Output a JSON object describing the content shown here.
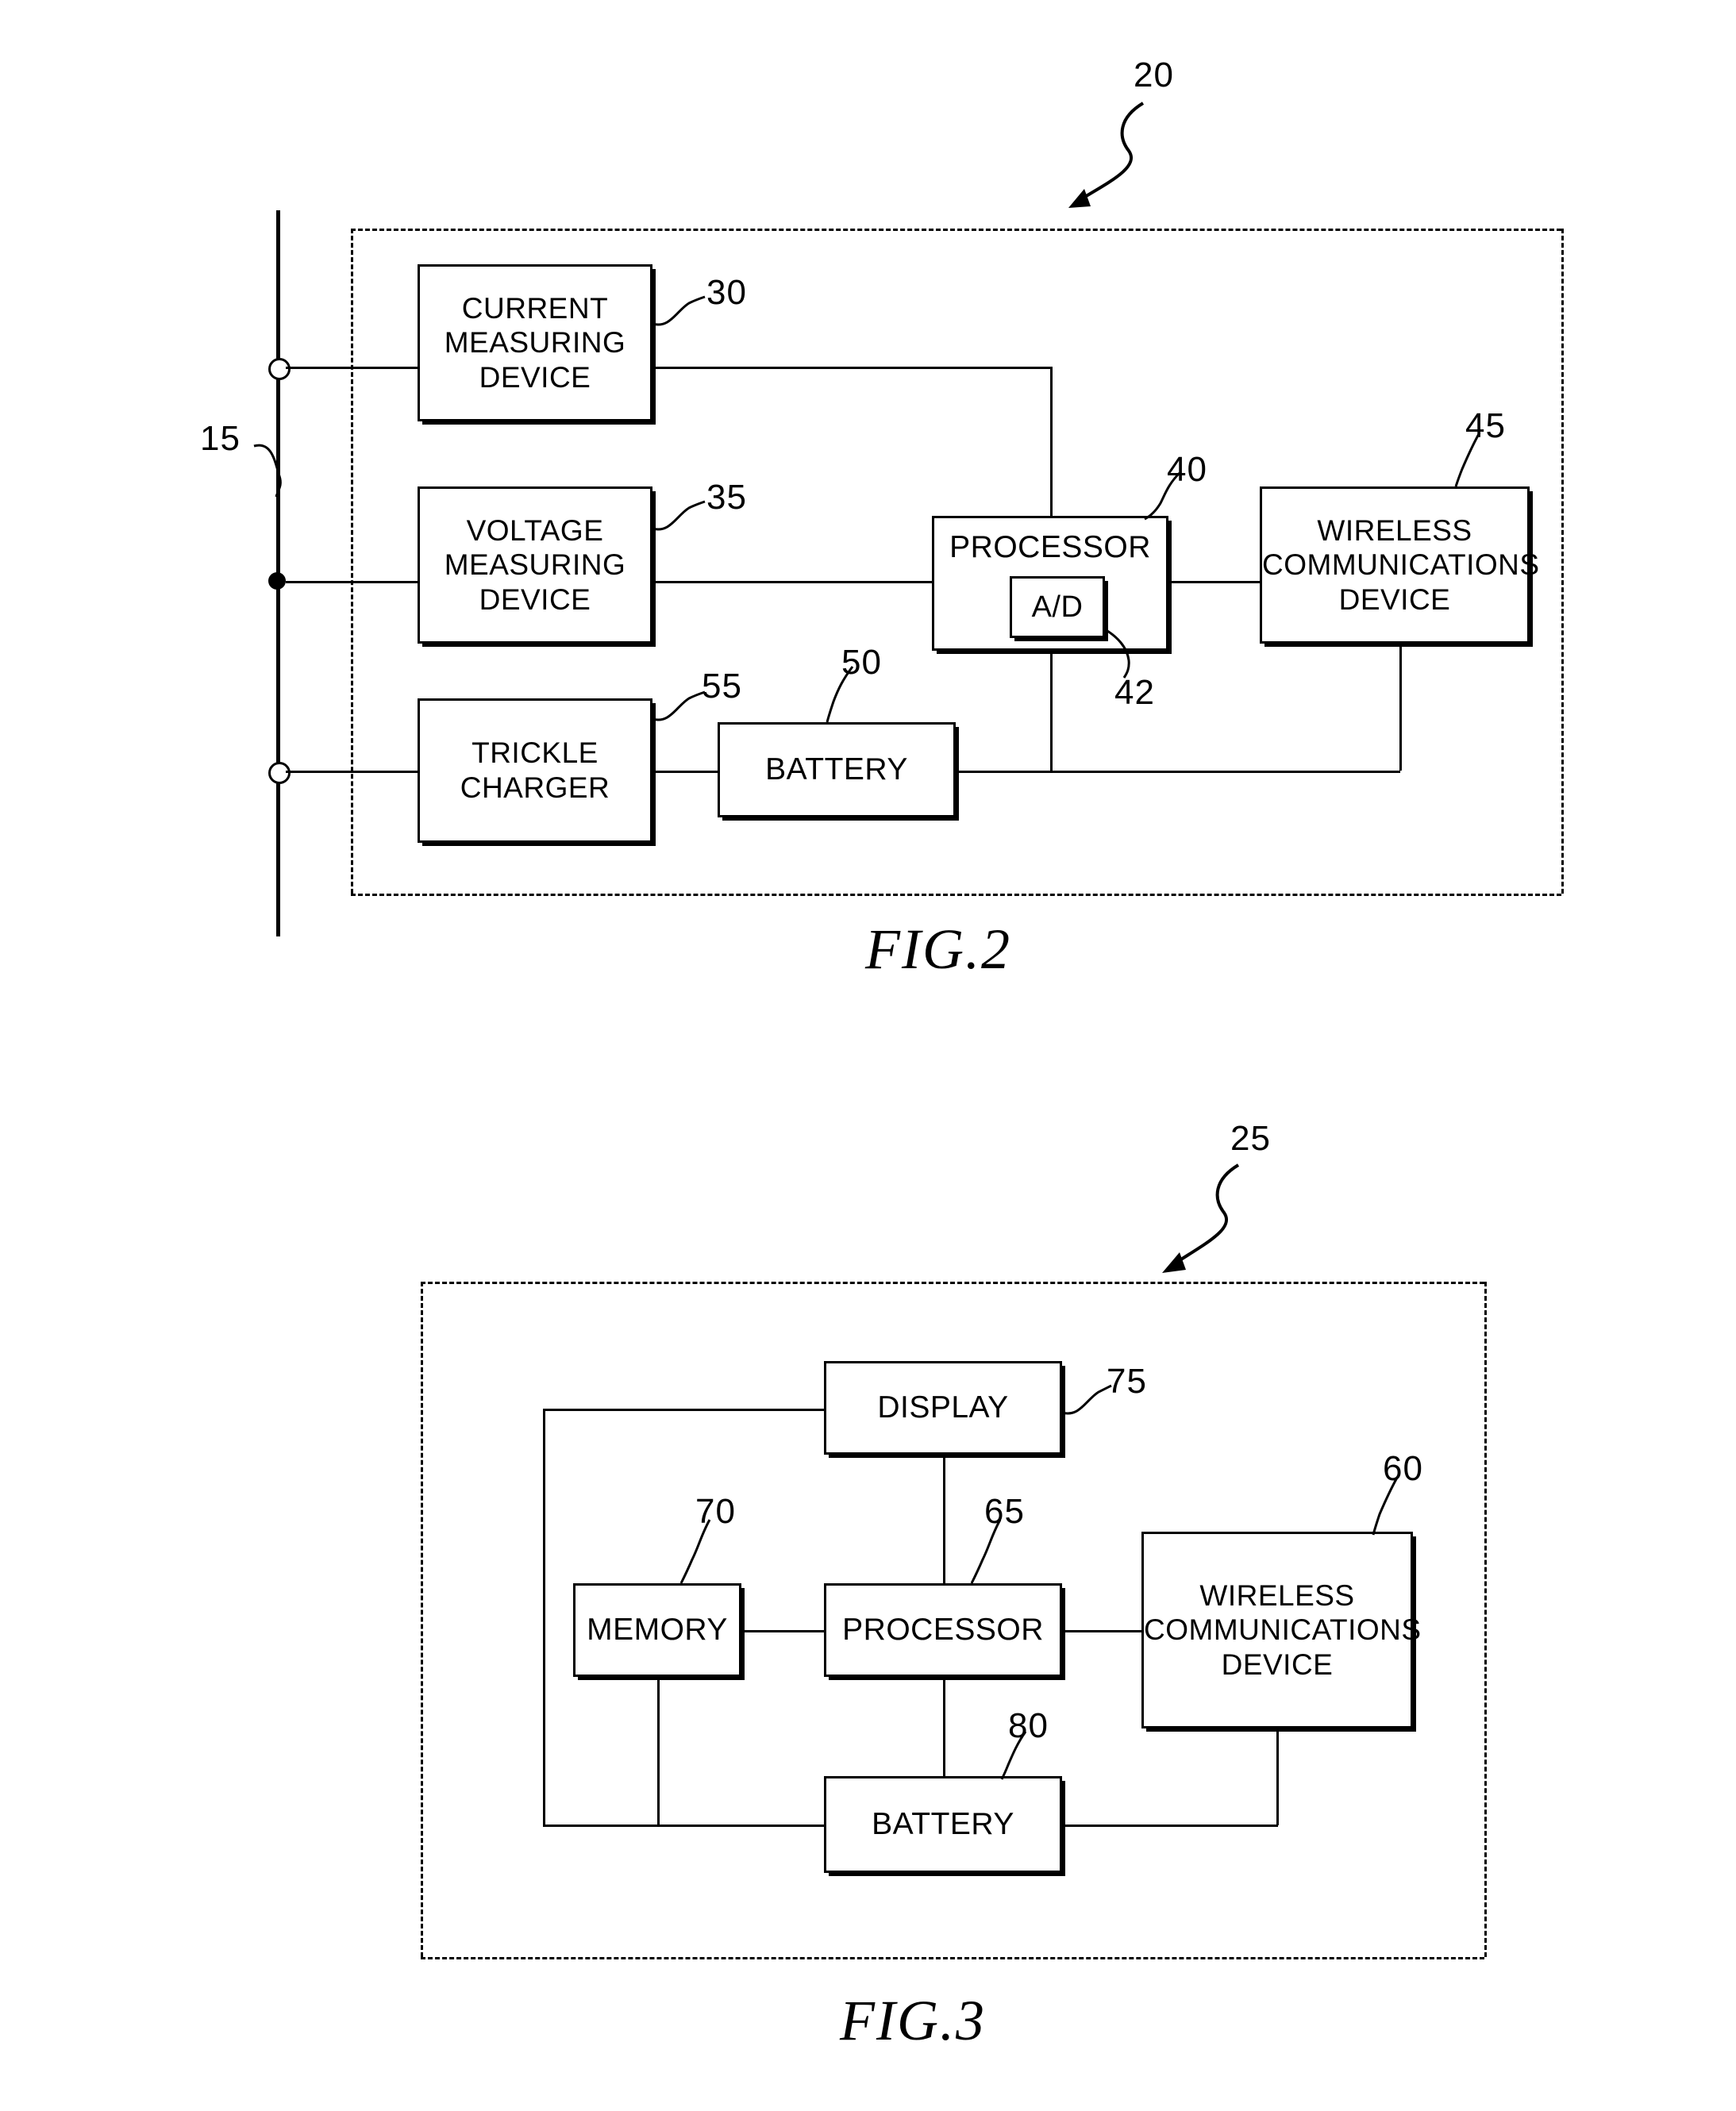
{
  "figures": [
    {
      "id": "fig2",
      "caption": "FIG.2",
      "assembly_ref": "20",
      "line_ref": "15",
      "blocks": [
        {
          "key": "current_measuring_device",
          "label": "CURRENT\nMEASURING\nDEVICE",
          "ref": "30"
        },
        {
          "key": "voltage_measuring_device",
          "label": "VOLTAGE\nMEASURING\nDEVICE",
          "ref": "35"
        },
        {
          "key": "trickle_charger",
          "label": "TRICKLE\nCHARGER",
          "ref": "55"
        },
        {
          "key": "battery",
          "label": "BATTERY",
          "ref": "50"
        },
        {
          "key": "processor",
          "label": "PROCESSOR",
          "ref": "40"
        },
        {
          "key": "ad_converter",
          "label": "A/D",
          "ref": "42"
        },
        {
          "key": "wireless_communications_device",
          "label": "WIRELESS\nCOMMUNICATIONS\nDEVICE",
          "ref": "45"
        }
      ]
    },
    {
      "id": "fig3",
      "caption": "FIG.3",
      "assembly_ref": "25",
      "blocks": [
        {
          "key": "display",
          "label": "DISPLAY",
          "ref": "75"
        },
        {
          "key": "memory",
          "label": "MEMORY",
          "ref": "70"
        },
        {
          "key": "processor",
          "label": "PROCESSOR",
          "ref": "65"
        },
        {
          "key": "wireless_communications_device",
          "label": "WIRELESS\nCOMMUNICATIONS\nDEVICE",
          "ref": "60"
        },
        {
          "key": "battery",
          "label": "BATTERY",
          "ref": "80"
        }
      ]
    }
  ],
  "fig2": {
    "caption": "FIG.2",
    "ref_20": "20",
    "ref_15": "15",
    "ref_30": "30",
    "ref_35": "35",
    "ref_40": "40",
    "ref_42": "42",
    "ref_45": "45",
    "ref_50": "50",
    "ref_55": "55",
    "current_measuring_device": "CURRENT MEASURING DEVICE",
    "cmd_l1": "CURRENT",
    "cmd_l2": "MEASURING",
    "cmd_l3": "DEVICE",
    "vmd_l1": "VOLTAGE",
    "vmd_l2": "MEASURING",
    "vmd_l3": "DEVICE",
    "tc_l1": "TRICKLE",
    "tc_l2": "CHARGER",
    "battery": "BATTERY",
    "processor": "PROCESSOR",
    "ad": "A/D",
    "wcd_l1": "WIRELESS",
    "wcd_l2": "COMMUNICATIONS",
    "wcd_l3": "DEVICE"
  },
  "fig3": {
    "caption": "FIG.3",
    "ref_25": "25",
    "ref_60": "60",
    "ref_65": "65",
    "ref_70": "70",
    "ref_75": "75",
    "ref_80": "80",
    "display": "DISPLAY",
    "memory": "MEMORY",
    "processor": "PROCESSOR",
    "battery": "BATTERY",
    "wcd_l1": "WIRELESS",
    "wcd_l2": "COMMUNICATIONS",
    "wcd_l3": "DEVICE"
  },
  "colors": {
    "ink": "#000000",
    "paper": "#ffffff"
  }
}
